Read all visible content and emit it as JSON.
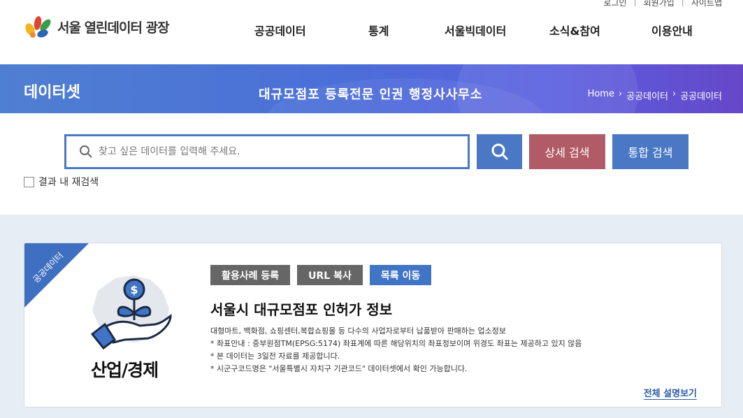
{
  "util_links": [
    "로그인",
    "회원가입",
    "사이트맵"
  ],
  "logo": {
    "text": "서울 열린데이터 광장"
  },
  "nav": [
    "공공데이터",
    "통계",
    "서울빅데이터",
    "소식&참여",
    "이용안내"
  ],
  "banner": {
    "title": "데이터셋",
    "subtitle": "대규모점포 등록전문 인권 행정사사무소",
    "breadcrumb": [
      "Home",
      "공공데이터",
      "공공데이터"
    ]
  },
  "search": {
    "placeholder": "찾고 싶은 데이터를 입력해 주세요.",
    "value": "",
    "detail_label": "상세 검색",
    "all_label": "통합 검색",
    "research_label": "결과 내 재검색",
    "research_checked": false
  },
  "card": {
    "ribbon": "공공데이터",
    "category": "산업/경제",
    "actions": [
      "활용사례 등록",
      "URL 복사",
      "목록 이동"
    ],
    "title": "서울시 대규모점포 인허가 정보",
    "desc": [
      "대형마트, 백화점, 쇼핑센터,복합쇼핑몰 등 다수의 사업자로부터 납품받아 판매하는 업소정보",
      "* 좌표안내 : 중부원점TM(EPSG:5174) 좌표계에 따른 해당위치의 좌표정보이며 위경도 좌표는 제공하고 있지 않음",
      "* 본 데이터는 3일전 자료를 제공합니다.",
      "* 시군구코드명은 \"서울특별시 자치구 기관코드\" 데이터셋에서 확인 가능합니다."
    ],
    "more": "전체 설명보기"
  },
  "colors": {
    "primary": "#4a78c5",
    "detail_button": "#b05b65",
    "ribbon": "#3f6fc1",
    "content_bg": "#e7edf4"
  },
  "icons": [
    "search-icon",
    "money-plant-icon",
    "seoul-map-icon",
    "chevron-right-icon"
  ]
}
